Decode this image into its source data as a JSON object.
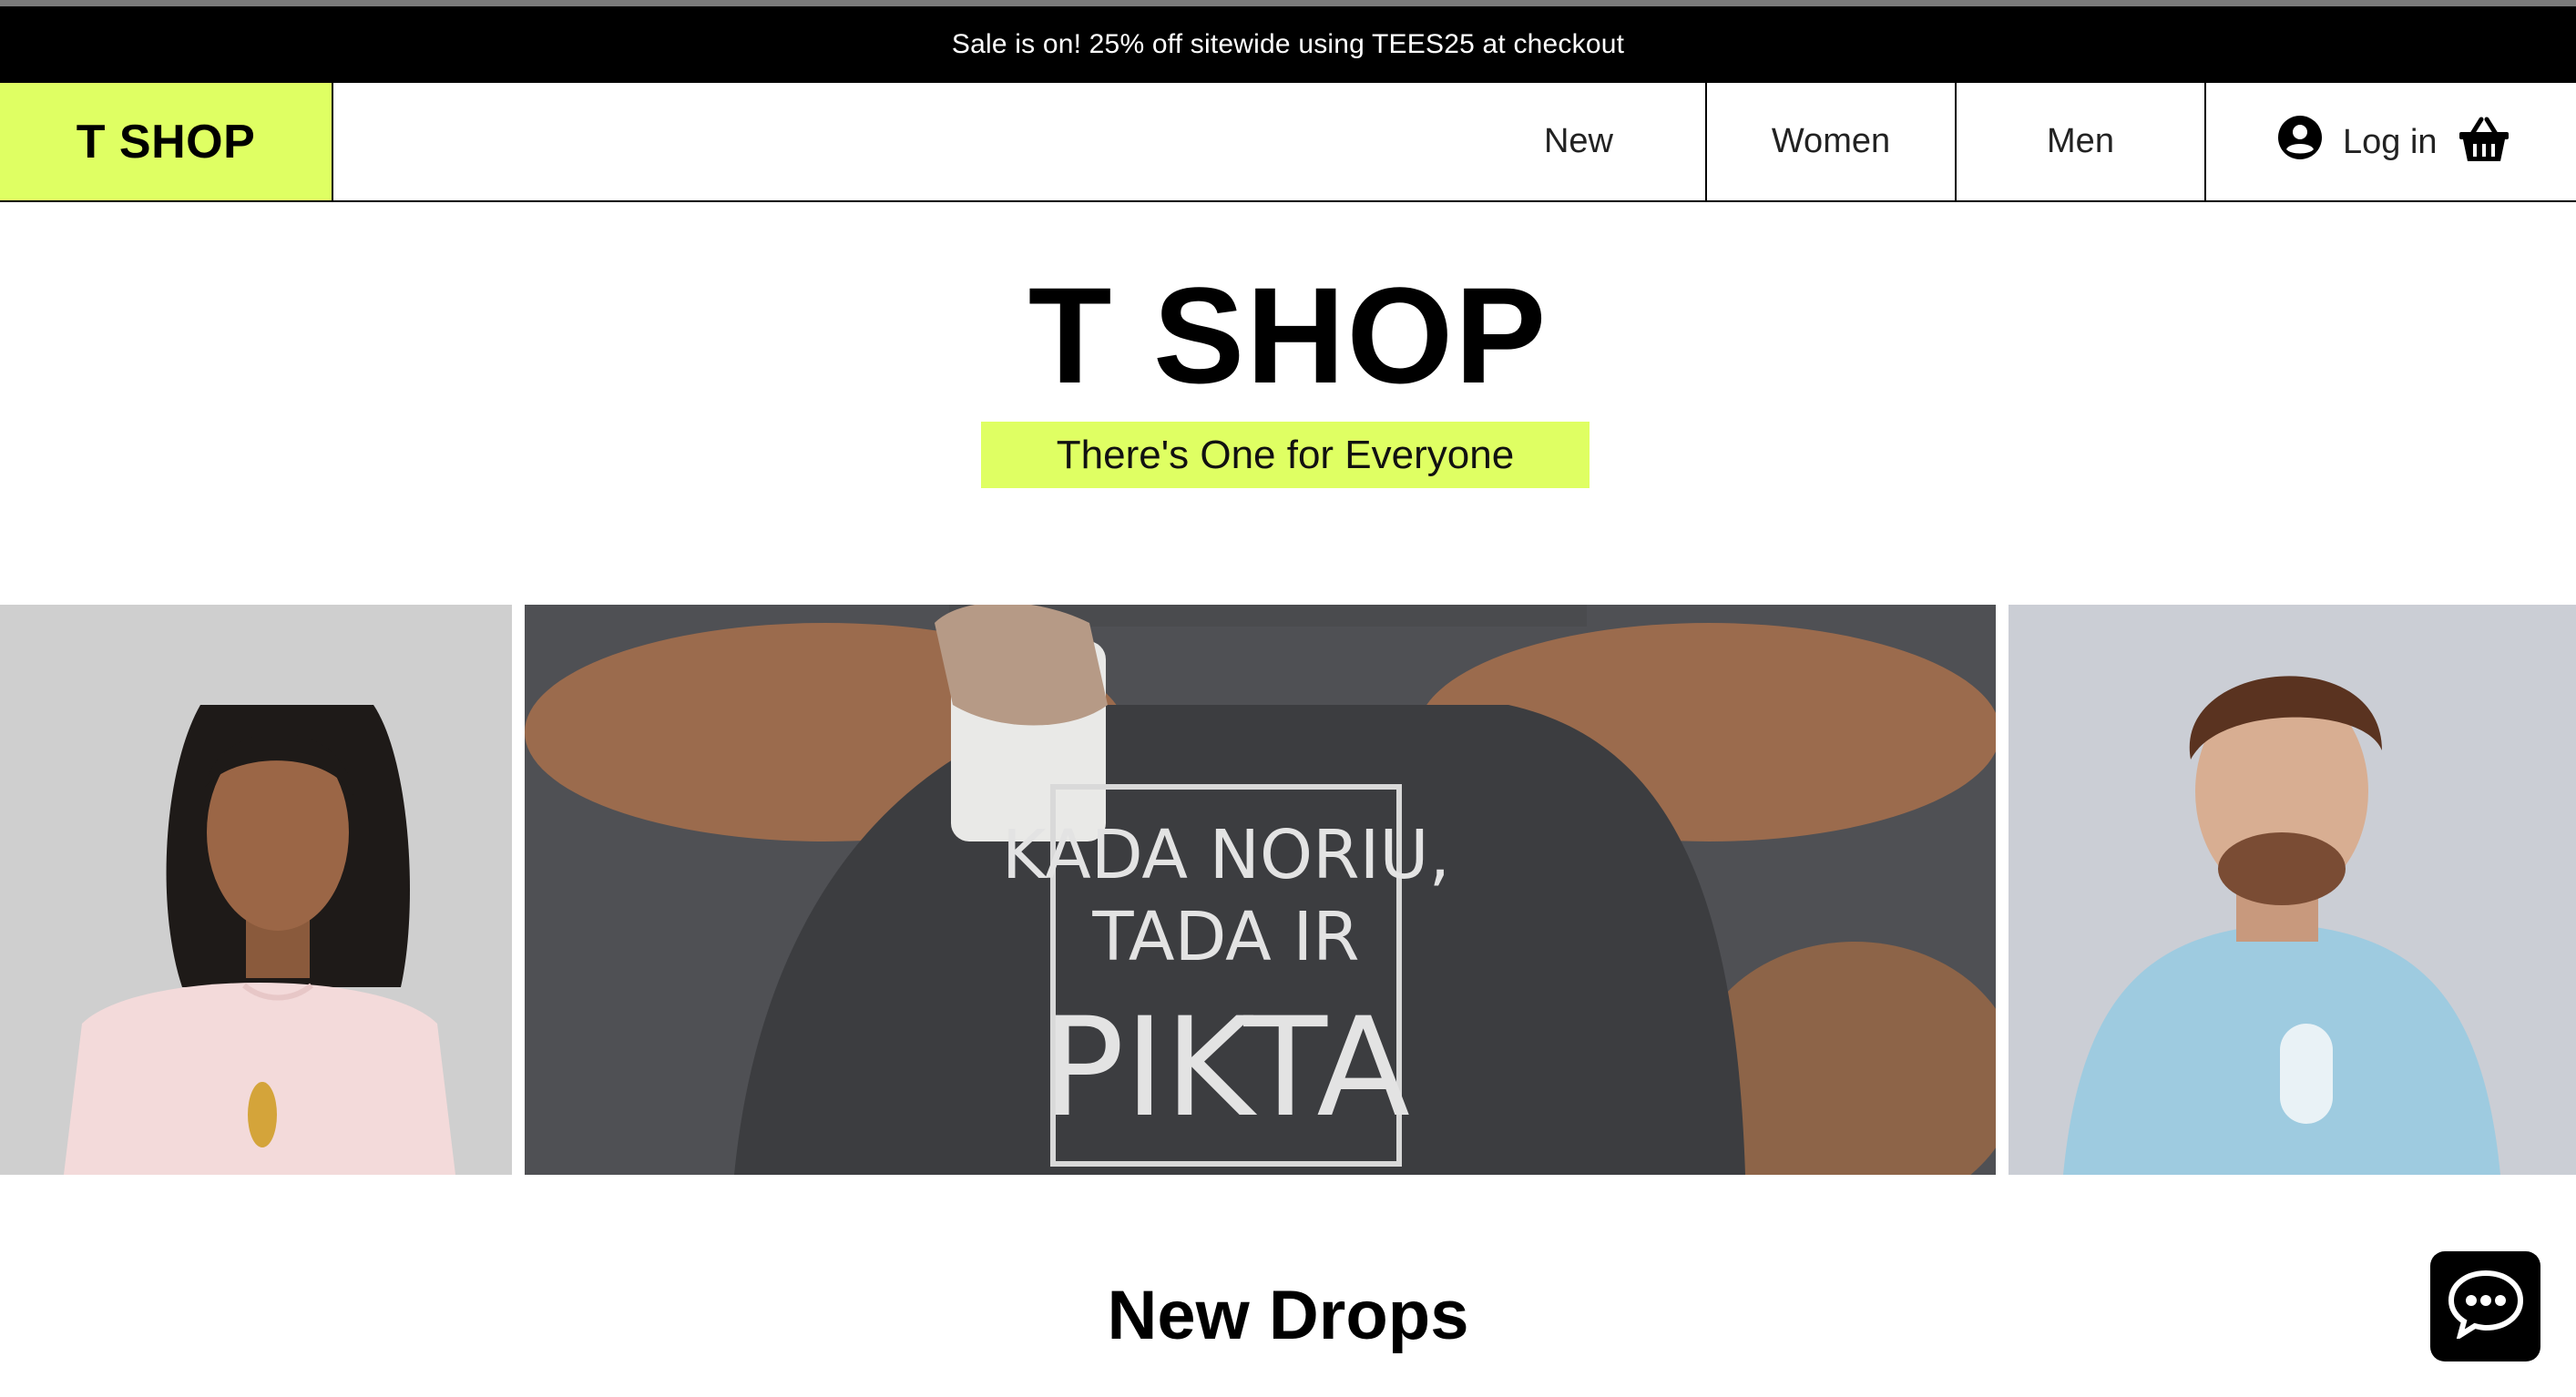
{
  "announcement": {
    "text": "Sale is on! 25% off sitewide using TEES25 at checkout"
  },
  "header": {
    "logo": "T SHOP",
    "nav": [
      {
        "label": "New"
      },
      {
        "label": "Women"
      },
      {
        "label": "Men"
      }
    ],
    "login_label": "Log in",
    "icons": [
      "account-icon",
      "shopping-basket-icon"
    ]
  },
  "hero": {
    "title": "T SHOP",
    "tagline": "There's One for Everyone"
  },
  "gallery": {
    "sweatshirt_print": [
      "KADA NORIU,",
      "TADA IR",
      "PIKTA"
    ]
  },
  "section": {
    "title": "New Drops"
  },
  "chat": {
    "icon": "chat-bubble-icon"
  },
  "colors": {
    "accent": "#dfff63",
    "announcement_bg": "#000000",
    "text": "#000000"
  }
}
